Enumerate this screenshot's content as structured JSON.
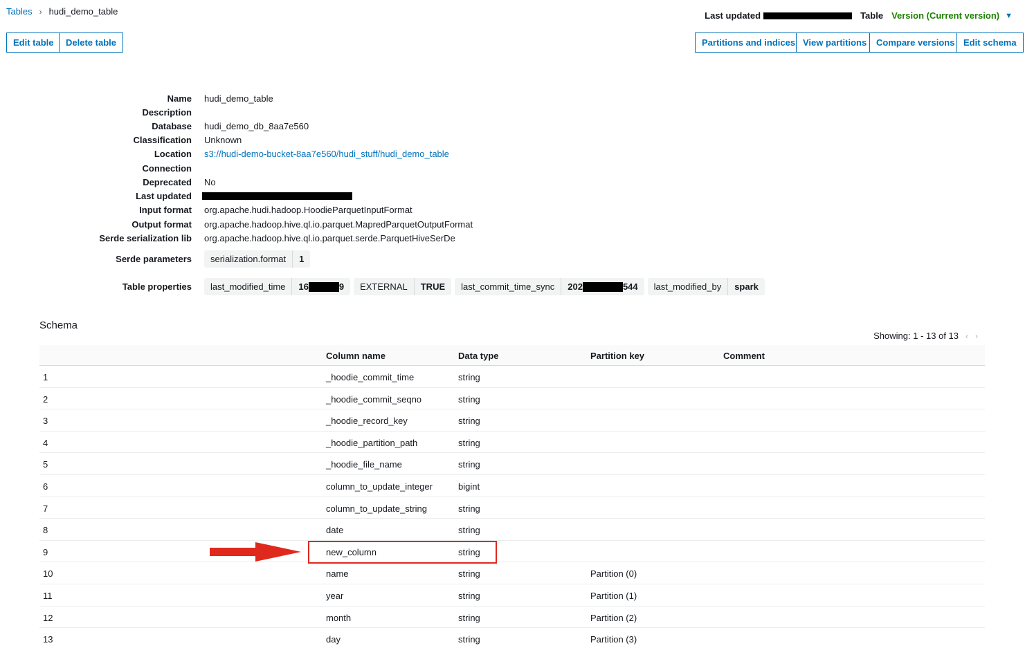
{
  "breadcrumb": {
    "root": "Tables",
    "current": "hudi_demo_table"
  },
  "header": {
    "last_updated_label": "Last updated",
    "table_label": "Table",
    "version_label": "Version (Current version)"
  },
  "actions": {
    "edit_table": "Edit table",
    "delete_table": "Delete table",
    "partitions_and_indices": "Partitions and indices",
    "view_partitions": "View partitions",
    "compare_versions": "Compare versions",
    "edit_schema": "Edit schema"
  },
  "details": [
    {
      "label": "Name",
      "value": "hudi_demo_table"
    },
    {
      "label": "Description",
      "value": ""
    },
    {
      "label": "Database",
      "value": "hudi_demo_db_8aa7e560"
    },
    {
      "label": "Classification",
      "value": "Unknown"
    },
    {
      "label": "Location",
      "value": "s3://hudi-demo-bucket-8aa7e560/hudi_stuff/hudi_demo_table"
    },
    {
      "label": "Connection",
      "value": ""
    },
    {
      "label": "Deprecated",
      "value": "No"
    },
    {
      "label": "Last updated",
      "value": ""
    },
    {
      "label": "Input format",
      "value": "org.apache.hudi.hadoop.HoodieParquetInputFormat"
    },
    {
      "label": "Output format",
      "value": "org.apache.hadoop.hive.ql.io.parquet.MapredParquetOutputFormat"
    },
    {
      "label": "Serde serialization lib",
      "value": "org.apache.hadoop.hive.ql.io.parquet.serde.ParquetHiveSerDe"
    }
  ],
  "serde_parameters": {
    "label": "Serde parameters",
    "items": [
      {
        "key": "serialization.format",
        "value": "1"
      }
    ]
  },
  "table_properties": {
    "label": "Table properties",
    "items": [
      {
        "key": "last_modified_time",
        "value_prefix": "16",
        "value_suffix": "9"
      },
      {
        "key": "EXTERNAL",
        "value": "TRUE"
      },
      {
        "key": "last_commit_time_sync",
        "value_prefix": "202",
        "value_suffix": "544"
      },
      {
        "key": "last_modified_by",
        "value": "spark"
      }
    ]
  },
  "schema": {
    "title": "Schema",
    "showing": "Showing: 1 - 13 of 13",
    "columns": [
      "Column name",
      "Data type",
      "Partition key",
      "Comment"
    ],
    "rows": [
      {
        "n": "1",
        "name": "_hoodie_commit_time",
        "type": "string",
        "partition": "",
        "comment": ""
      },
      {
        "n": "2",
        "name": "_hoodie_commit_seqno",
        "type": "string",
        "partition": "",
        "comment": ""
      },
      {
        "n": "3",
        "name": "_hoodie_record_key",
        "type": "string",
        "partition": "",
        "comment": ""
      },
      {
        "n": "4",
        "name": "_hoodie_partition_path",
        "type": "string",
        "partition": "",
        "comment": ""
      },
      {
        "n": "5",
        "name": "_hoodie_file_name",
        "type": "string",
        "partition": "",
        "comment": ""
      },
      {
        "n": "6",
        "name": "column_to_update_integer",
        "type": "bigint",
        "partition": "",
        "comment": ""
      },
      {
        "n": "7",
        "name": "column_to_update_string",
        "type": "string",
        "partition": "",
        "comment": ""
      },
      {
        "n": "8",
        "name": "date",
        "type": "string",
        "partition": "",
        "comment": ""
      },
      {
        "n": "9",
        "name": "new_column",
        "type": "string",
        "partition": "",
        "comment": ""
      },
      {
        "n": "10",
        "name": "name",
        "type": "string",
        "partition": "Partition (0)",
        "comment": ""
      },
      {
        "n": "11",
        "name": "year",
        "type": "string",
        "partition": "Partition (1)",
        "comment": ""
      },
      {
        "n": "12",
        "name": "month",
        "type": "string",
        "partition": "Partition (2)",
        "comment": ""
      },
      {
        "n": "13",
        "name": "day",
        "type": "string",
        "partition": "Partition (3)",
        "comment": ""
      }
    ]
  },
  "colors": {
    "link": "#0073bb",
    "version": "#1d8102",
    "highlight": "#e0291d"
  }
}
